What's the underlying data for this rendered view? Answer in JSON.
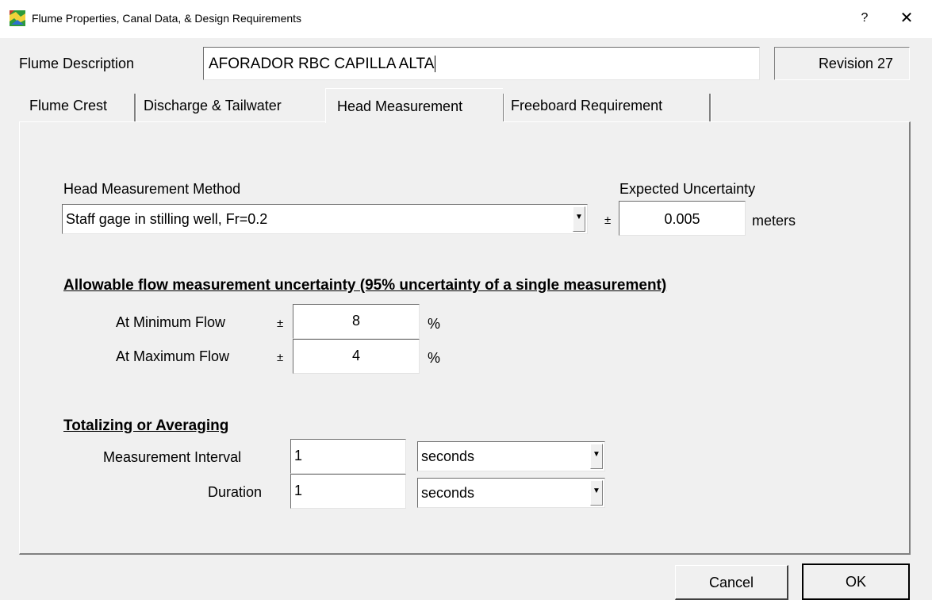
{
  "window": {
    "title": "Flume Properties, Canal Data, & Design Requirements",
    "help_glyph": "?",
    "close_glyph": "✕"
  },
  "description": {
    "label": "Flume Description",
    "value": "AFORADOR RBC CAPILLA ALTA",
    "revision": "Revision 27"
  },
  "tabs": [
    {
      "label": "Flume Crest",
      "active": false
    },
    {
      "label": "Discharge & Tailwater",
      "active": false
    },
    {
      "label": "Head Measurement",
      "active": true
    },
    {
      "label": "Freeboard Requirement",
      "active": false
    }
  ],
  "head_measurement": {
    "method_label": "Head Measurement Method",
    "method_value": "Staff gage in stilling well, Fr=0.2",
    "uncertainty_label": "Expected Uncertainty",
    "plus_minus": "±",
    "uncertainty_value": "0.005",
    "uncertainty_unit": "meters"
  },
  "allowable": {
    "title": "Allowable flow measurement uncertainty (95% uncertainty of a single measurement)",
    "min_label": "At Minimum Flow",
    "min_value": "8",
    "max_label": "At Maximum Flow",
    "max_value": "4",
    "plus_minus": "±",
    "unit": "%"
  },
  "totalizing": {
    "title": "Totalizing or Averaging",
    "interval_label": "Measurement Interval",
    "interval_value": "1",
    "interval_unit": "seconds",
    "duration_label": "Duration",
    "duration_value": "1",
    "duration_unit": "seconds"
  },
  "buttons": {
    "cancel": "Cancel",
    "ok": "OK"
  },
  "colors": {
    "background": "#f0f0f0",
    "titlebar": "#ffffff"
  },
  "icons": {
    "app": "app-map-icon",
    "dropdown": "chevron-down-icon"
  }
}
